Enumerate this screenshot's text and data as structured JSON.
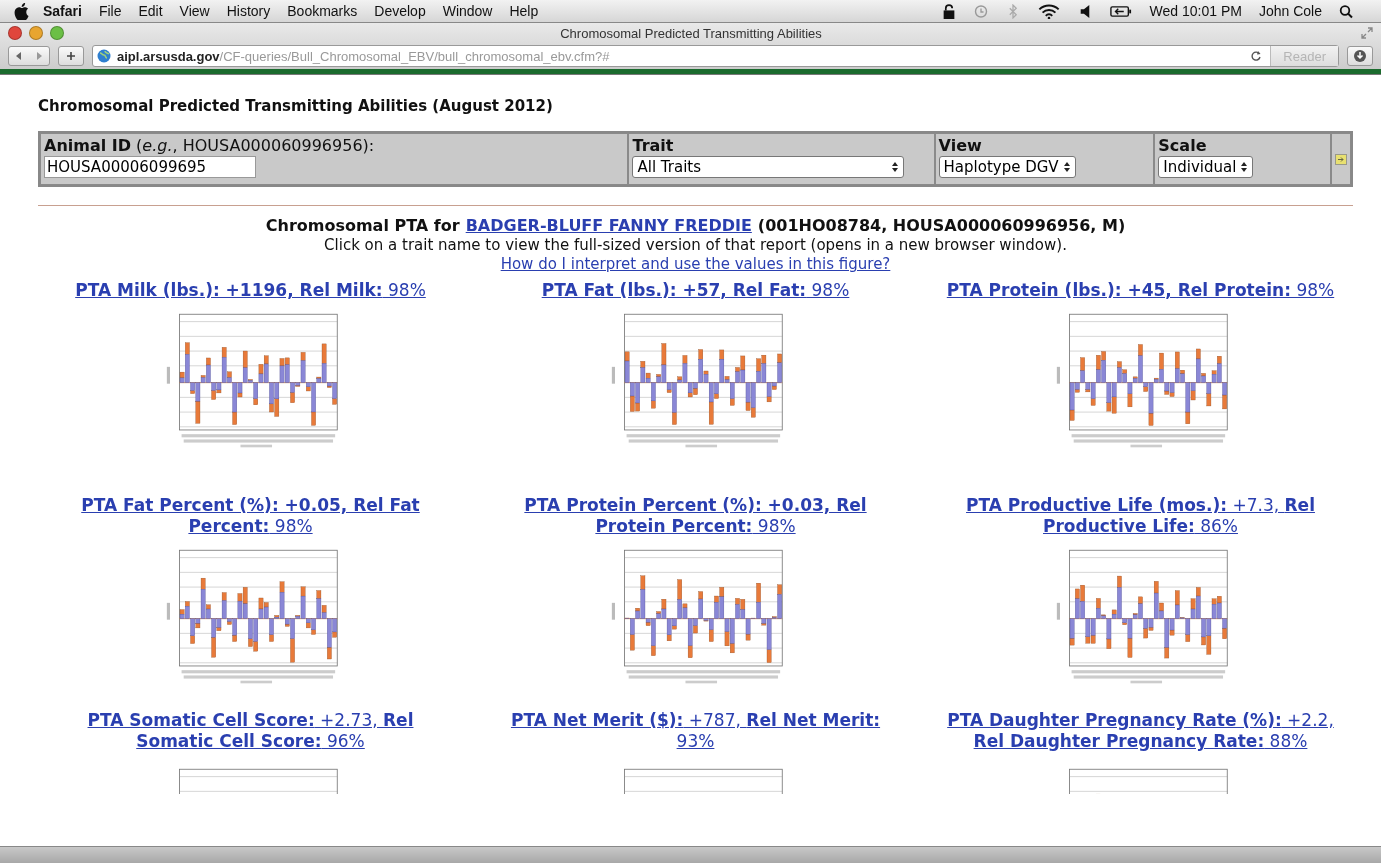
{
  "menu_bar": {
    "app": "Safari",
    "items": [
      "File",
      "Edit",
      "View",
      "History",
      "Bookmarks",
      "Develop",
      "Window",
      "Help"
    ],
    "clock": "Wed 10:01 PM",
    "user": "John Cole"
  },
  "window": {
    "title": "Chromosomal Predicted Transmitting Abilities"
  },
  "toolbar": {
    "url_host": "aipl.arsusda.gov",
    "url_path": "/CF-queries/Bull_Chromosomal_EBV/bull_chromosomal_ebv.cfm?#",
    "reader_button": "Reader"
  },
  "page": {
    "heading": "Chromosomal Predicted Transmitting Abilities (August 2012)",
    "form": {
      "animal_id_label": "**Animal ID** (*e.g.*, HOUSA000060996956):",
      "animal_id_value": "HOUSA00006099695",
      "selects": [
        {
          "label": "Trait",
          "value": "All Traits"
        },
        {
          "label": "View",
          "value": "Haplotype DGV"
        },
        {
          "label": "Scale",
          "value": "Individual"
        }
      ]
    },
    "result": {
      "title_prefix": "Chromosomal PTA for",
      "animal_link": "BADGER-BLUFF FANNY FREDDIE",
      "title_suffix": "(001HO08784, HOUSA000060996956, M)",
      "instructions": "Click on a trait name to view the full-sized version of that report (opens in a new browser window).",
      "help_link": "How do I interpret and use the values in this figure?"
    },
    "reports": [
      {
        "title": "**PTA Milk (lbs.): +1196, Rel Milk:** 98%"
      },
      {
        "title": "**PTA Fat (lbs.): +57, Rel Fat:** 98%"
      },
      {
        "title": "**PTA Protein (lbs.): +45, Rel Protein:** 98%"
      },
      {
        "title": "**PTA Fat Percent (%): +0.05, Rel Fat Percent:** 98%"
      },
      {
        "title": "**PTA Protein Percent (%): +0.03, Rel Protein Percent:** 98%"
      },
      {
        "title": "**PTA Productive Life (mos.):** +7.3, **Rel Productive Life:** 86%"
      },
      {
        "title": "**PTA Somatic Cell Score:** +2.73, **Rel Somatic Cell Score:** 96%"
      },
      {
        "title": "**PTA Net Merit ($):** +787, **Rel Net Merit:** 93%"
      },
      {
        "title": "**PTA Daughter Pregnancy Rate (%):** +2.2, **Rel Daughter Pregnancy Rate:** 88%"
      }
    ]
  }
}
